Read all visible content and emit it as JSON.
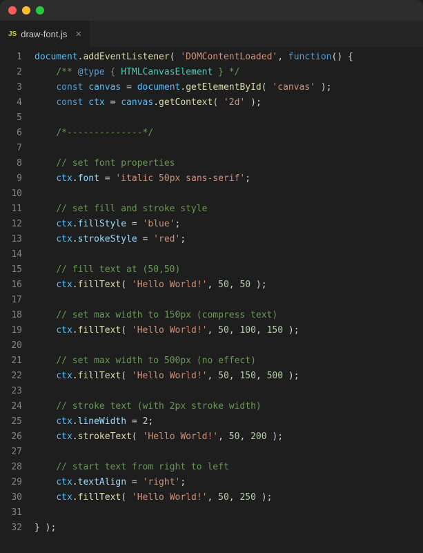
{
  "tab": {
    "filename": "draw-font.js",
    "icon_label": "JS",
    "close_glyph": "×"
  },
  "gutter": {
    "lines": [
      "1",
      "2",
      "3",
      "4",
      "5",
      "6",
      "7",
      "8",
      "9",
      "10",
      "11",
      "12",
      "13",
      "14",
      "15",
      "16",
      "17",
      "18",
      "19",
      "20",
      "21",
      "22",
      "23",
      "24",
      "25",
      "26",
      "27",
      "28",
      "29",
      "30",
      "31",
      "32"
    ]
  },
  "code": {
    "lines": [
      [
        {
          "t": "document",
          "c": "c-obj"
        },
        {
          "t": ".",
          "c": "c-pun"
        },
        {
          "t": "addEventListener",
          "c": "c-fn"
        },
        {
          "t": "( ",
          "c": "c-pun"
        },
        {
          "t": "'DOMContentLoaded'",
          "c": "c-str"
        },
        {
          "t": ", ",
          "c": "c-pun"
        },
        {
          "t": "function",
          "c": "c-key"
        },
        {
          "t": "() {",
          "c": "c-pun"
        }
      ],
      [
        {
          "t": "    ",
          "c": "c-pun"
        },
        {
          "t": "/** ",
          "c": "c-com"
        },
        {
          "t": "@type",
          "c": "c-key"
        },
        {
          "t": " {",
          "c": "c-com"
        },
        {
          "t": " HTMLCanvasElement ",
          "c": "c-type"
        },
        {
          "t": "}",
          "c": "c-com"
        },
        {
          "t": " */",
          "c": "c-com"
        }
      ],
      [
        {
          "t": "    ",
          "c": "c-pun"
        },
        {
          "t": "const ",
          "c": "c-key"
        },
        {
          "t": "canvas",
          "c": "c-obj"
        },
        {
          "t": " = ",
          "c": "c-pun"
        },
        {
          "t": "document",
          "c": "c-obj"
        },
        {
          "t": ".",
          "c": "c-pun"
        },
        {
          "t": "getElementById",
          "c": "c-fn"
        },
        {
          "t": "( ",
          "c": "c-pun"
        },
        {
          "t": "'canvas'",
          "c": "c-str"
        },
        {
          "t": " );",
          "c": "c-pun"
        }
      ],
      [
        {
          "t": "    ",
          "c": "c-pun"
        },
        {
          "t": "const ",
          "c": "c-key"
        },
        {
          "t": "ctx",
          "c": "c-obj"
        },
        {
          "t": " = ",
          "c": "c-pun"
        },
        {
          "t": "canvas",
          "c": "c-obj"
        },
        {
          "t": ".",
          "c": "c-pun"
        },
        {
          "t": "getContext",
          "c": "c-fn"
        },
        {
          "t": "( ",
          "c": "c-pun"
        },
        {
          "t": "'2d'",
          "c": "c-str"
        },
        {
          "t": " );",
          "c": "c-pun"
        }
      ],
      [],
      [
        {
          "t": "    ",
          "c": "c-pun"
        },
        {
          "t": "/*--------------*/",
          "c": "c-com"
        }
      ],
      [],
      [
        {
          "t": "    ",
          "c": "c-pun"
        },
        {
          "t": "// set font properties",
          "c": "c-com"
        }
      ],
      [
        {
          "t": "    ",
          "c": "c-pun"
        },
        {
          "t": "ctx",
          "c": "c-obj"
        },
        {
          "t": ".",
          "c": "c-pun"
        },
        {
          "t": "font",
          "c": "c-var"
        },
        {
          "t": " = ",
          "c": "c-pun"
        },
        {
          "t": "'italic 50px sans-serif'",
          "c": "c-str"
        },
        {
          "t": ";",
          "c": "c-pun"
        }
      ],
      [],
      [
        {
          "t": "    ",
          "c": "c-pun"
        },
        {
          "t": "// set fill and stroke style",
          "c": "c-com"
        }
      ],
      [
        {
          "t": "    ",
          "c": "c-pun"
        },
        {
          "t": "ctx",
          "c": "c-obj"
        },
        {
          "t": ".",
          "c": "c-pun"
        },
        {
          "t": "fillStyle",
          "c": "c-var"
        },
        {
          "t": " = ",
          "c": "c-pun"
        },
        {
          "t": "'blue'",
          "c": "c-str"
        },
        {
          "t": ";",
          "c": "c-pun"
        }
      ],
      [
        {
          "t": "    ",
          "c": "c-pun"
        },
        {
          "t": "ctx",
          "c": "c-obj"
        },
        {
          "t": ".",
          "c": "c-pun"
        },
        {
          "t": "strokeStyle",
          "c": "c-var"
        },
        {
          "t": " = ",
          "c": "c-pun"
        },
        {
          "t": "'red'",
          "c": "c-str"
        },
        {
          "t": ";",
          "c": "c-pun"
        }
      ],
      [],
      [
        {
          "t": "    ",
          "c": "c-pun"
        },
        {
          "t": "// fill text at (50,50)",
          "c": "c-com"
        }
      ],
      [
        {
          "t": "    ",
          "c": "c-pun"
        },
        {
          "t": "ctx",
          "c": "c-obj"
        },
        {
          "t": ".",
          "c": "c-pun"
        },
        {
          "t": "fillText",
          "c": "c-fn"
        },
        {
          "t": "( ",
          "c": "c-pun"
        },
        {
          "t": "'Hello World!'",
          "c": "c-str"
        },
        {
          "t": ", ",
          "c": "c-pun"
        },
        {
          "t": "50",
          "c": "c-num"
        },
        {
          "t": ", ",
          "c": "c-pun"
        },
        {
          "t": "50",
          "c": "c-num"
        },
        {
          "t": " );",
          "c": "c-pun"
        }
      ],
      [],
      [
        {
          "t": "    ",
          "c": "c-pun"
        },
        {
          "t": "// set max width to 150px (compress text)",
          "c": "c-com"
        }
      ],
      [
        {
          "t": "    ",
          "c": "c-pun"
        },
        {
          "t": "ctx",
          "c": "c-obj"
        },
        {
          "t": ".",
          "c": "c-pun"
        },
        {
          "t": "fillText",
          "c": "c-fn"
        },
        {
          "t": "( ",
          "c": "c-pun"
        },
        {
          "t": "'Hello World!'",
          "c": "c-str"
        },
        {
          "t": ", ",
          "c": "c-pun"
        },
        {
          "t": "50",
          "c": "c-num"
        },
        {
          "t": ", ",
          "c": "c-pun"
        },
        {
          "t": "100",
          "c": "c-num"
        },
        {
          "t": ", ",
          "c": "c-pun"
        },
        {
          "t": "150",
          "c": "c-num"
        },
        {
          "t": " );",
          "c": "c-pun"
        }
      ],
      [],
      [
        {
          "t": "    ",
          "c": "c-pun"
        },
        {
          "t": "// set max width to 500px (no effect)",
          "c": "c-com"
        }
      ],
      [
        {
          "t": "    ",
          "c": "c-pun"
        },
        {
          "t": "ctx",
          "c": "c-obj"
        },
        {
          "t": ".",
          "c": "c-pun"
        },
        {
          "t": "fillText",
          "c": "c-fn"
        },
        {
          "t": "( ",
          "c": "c-pun"
        },
        {
          "t": "'Hello World!'",
          "c": "c-str"
        },
        {
          "t": ", ",
          "c": "c-pun"
        },
        {
          "t": "50",
          "c": "c-num"
        },
        {
          "t": ", ",
          "c": "c-pun"
        },
        {
          "t": "150",
          "c": "c-num"
        },
        {
          "t": ", ",
          "c": "c-pun"
        },
        {
          "t": "500",
          "c": "c-num"
        },
        {
          "t": " );",
          "c": "c-pun"
        }
      ],
      [],
      [
        {
          "t": "    ",
          "c": "c-pun"
        },
        {
          "t": "// stroke text (with 2px stroke width)",
          "c": "c-com"
        }
      ],
      [
        {
          "t": "    ",
          "c": "c-pun"
        },
        {
          "t": "ctx",
          "c": "c-obj"
        },
        {
          "t": ".",
          "c": "c-pun"
        },
        {
          "t": "lineWidth",
          "c": "c-var"
        },
        {
          "t": " = ",
          "c": "c-pun"
        },
        {
          "t": "2",
          "c": "c-num"
        },
        {
          "t": ";",
          "c": "c-pun"
        }
      ],
      [
        {
          "t": "    ",
          "c": "c-pun"
        },
        {
          "t": "ctx",
          "c": "c-obj"
        },
        {
          "t": ".",
          "c": "c-pun"
        },
        {
          "t": "strokeText",
          "c": "c-fn"
        },
        {
          "t": "( ",
          "c": "c-pun"
        },
        {
          "t": "'Hello World!'",
          "c": "c-str"
        },
        {
          "t": ", ",
          "c": "c-pun"
        },
        {
          "t": "50",
          "c": "c-num"
        },
        {
          "t": ", ",
          "c": "c-pun"
        },
        {
          "t": "200",
          "c": "c-num"
        },
        {
          "t": " );",
          "c": "c-pun"
        }
      ],
      [],
      [
        {
          "t": "    ",
          "c": "c-pun"
        },
        {
          "t": "// start text from right to left",
          "c": "c-com"
        }
      ],
      [
        {
          "t": "    ",
          "c": "c-pun"
        },
        {
          "t": "ctx",
          "c": "c-obj"
        },
        {
          "t": ".",
          "c": "c-pun"
        },
        {
          "t": "textAlign",
          "c": "c-var"
        },
        {
          "t": " = ",
          "c": "c-pun"
        },
        {
          "t": "'right'",
          "c": "c-str"
        },
        {
          "t": ";",
          "c": "c-pun"
        }
      ],
      [
        {
          "t": "    ",
          "c": "c-pun"
        },
        {
          "t": "ctx",
          "c": "c-obj"
        },
        {
          "t": ".",
          "c": "c-pun"
        },
        {
          "t": "fillText",
          "c": "c-fn"
        },
        {
          "t": "( ",
          "c": "c-pun"
        },
        {
          "t": "'Hello World!'",
          "c": "c-str"
        },
        {
          "t": ", ",
          "c": "c-pun"
        },
        {
          "t": "50",
          "c": "c-num"
        },
        {
          "t": ", ",
          "c": "c-pun"
        },
        {
          "t": "250",
          "c": "c-num"
        },
        {
          "t": " );",
          "c": "c-pun"
        }
      ],
      [],
      [
        {
          "t": "} );",
          "c": "c-pun"
        }
      ]
    ]
  }
}
